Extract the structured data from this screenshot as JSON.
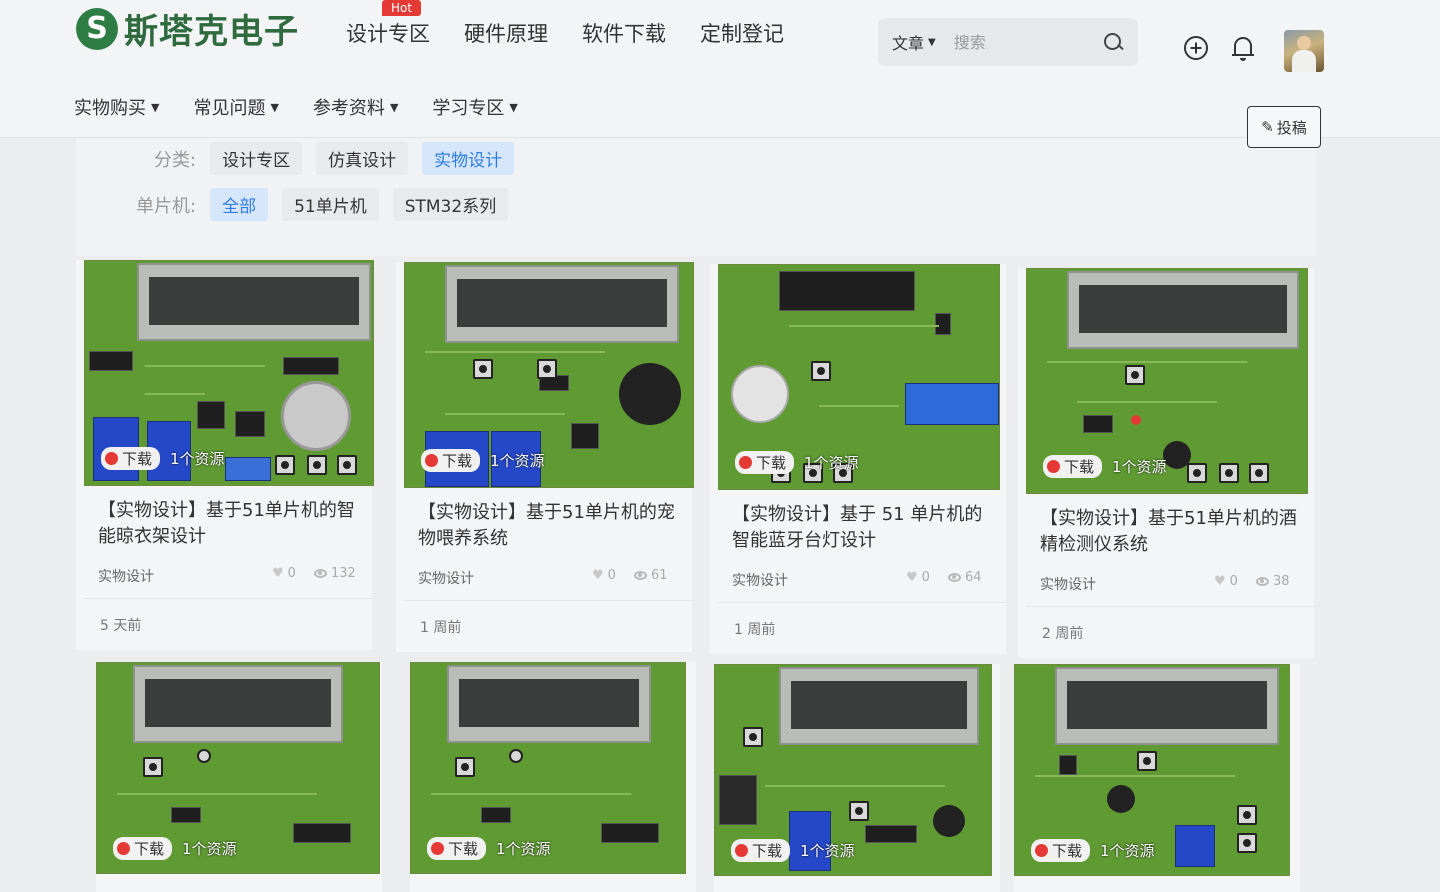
{
  "brand": {
    "logo_letter": "S",
    "name": "斯塔克电子",
    "color": "#2f6b3e"
  },
  "topnav": {
    "items": [
      "设计专区",
      "硬件原理",
      "软件下载",
      "定制登记"
    ],
    "hot_badge": "Hot"
  },
  "search": {
    "type_label": "文章",
    "placeholder": "搜索"
  },
  "subnav": {
    "items": [
      "实物购买",
      "常见问题",
      "参考资料",
      "学习专区"
    ]
  },
  "post_button": {
    "label": "投稿"
  },
  "filters": {
    "category": {
      "label": "分类:",
      "options": [
        "设计专区",
        "仿真设计",
        "实物设计"
      ],
      "active": "实物设计"
    },
    "mcu": {
      "label": "单片机:",
      "options": [
        "全部",
        "51单片机",
        "STM32系列"
      ],
      "active": "全部"
    }
  },
  "cards": [
    {
      "title": "【实物设计】基于51单片机的智能晾衣架设计",
      "category": "实物设计",
      "likes": "0",
      "views": "132",
      "time": "5 天前",
      "download_label": "下载",
      "resource_label": "1个资源"
    },
    {
      "title": "【实物设计】基于51单片机的宠物喂养系统",
      "category": "实物设计",
      "likes": "0",
      "views": "61",
      "time": "1 周前",
      "download_label": "下载",
      "resource_label": "1个资源"
    },
    {
      "title": "【实物设计】基于 51 单片机的智能蓝牙台灯设计",
      "category": "实物设计",
      "likes": "0",
      "views": "64",
      "time": "1 周前",
      "download_label": "下载",
      "resource_label": "1个资源"
    },
    {
      "title": "【实物设计】基于51单片机的酒精检测仪系统",
      "category": "实物设计",
      "likes": "0",
      "views": "38",
      "time": "2 周前",
      "download_label": "下载",
      "resource_label": "1个资源"
    }
  ],
  "cards_row2": [
    {
      "download_label": "下载",
      "resource_label": "1个资源"
    },
    {
      "download_label": "下载",
      "resource_label": "1个资源"
    },
    {
      "download_label": "下载",
      "resource_label": "1个资源"
    },
    {
      "download_label": "下载",
      "resource_label": "1个资源"
    }
  ],
  "colors": {
    "active_chip_bg": "#d6e6fb",
    "active_chip_text": "#2f7de1",
    "hot_badge": "#e53935",
    "pcb_green": "#5f9a33"
  }
}
